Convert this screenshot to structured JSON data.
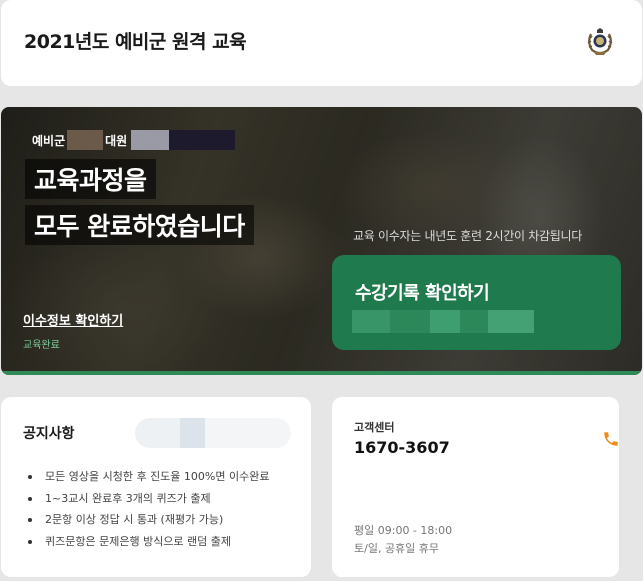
{
  "header": {
    "title": "2021년도 예비군 원격 교육",
    "emblem_icon": "reserve-forces-emblem-icon"
  },
  "hero": {
    "greeting_prefix": "예비군",
    "greeting_rank": "대원",
    "headline_line1": "교육과정을",
    "headline_line2": "모두 완료하였습니다",
    "note": "교육 이수자는 내년도 훈련 2시간이 차감됩니다",
    "history_button_label": "수강기록 확인하기",
    "completion_link": "이수정보 확인하기",
    "completion_status": "교육완료",
    "accent_color": "#1f7a4d"
  },
  "notice": {
    "title": "공지사항",
    "items": [
      "모든 영상을 시청한 후 진도율 100%면 이수완료",
      "1~3교시 완료후 3개의 퀴즈가 출제",
      "2문항 이상 정답 시 통과 (재평가 가능)",
      "퀴즈문항은 문제은행 방식으로 랜덤 출제"
    ]
  },
  "support": {
    "title": "고객센터",
    "phone": "1670-3607",
    "phone_icon": "phone-icon",
    "icon_color": "#f08a1c",
    "hours": "평일 09:00 - 18:00",
    "holiday": "토/일, 공휴일 휴무"
  }
}
